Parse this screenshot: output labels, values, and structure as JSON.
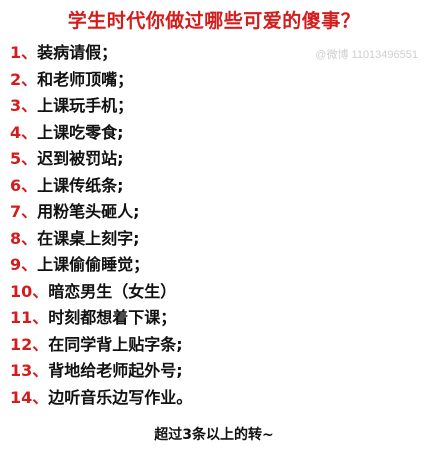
{
  "title": "学生时代你做过哪些可爱的傻事？",
  "watermark": "@微博 11013496551",
  "items": [
    {
      "num": "1、",
      "text": "装病请假；"
    },
    {
      "num": "2、",
      "text": "和老师顶嘴；"
    },
    {
      "num": "3、",
      "text": "上课玩手机；"
    },
    {
      "num": "4、",
      "text": "上课吃零食;"
    },
    {
      "num": "5、",
      "text": "迟到被罚站;"
    },
    {
      "num": "6、",
      "text": "上课传纸条;"
    },
    {
      "num": "7、",
      "text": "用粉笔头砸人;"
    },
    {
      "num": "8、",
      "text": "在课桌上刻字;"
    },
    {
      "num": "9、",
      "text": "上课偷偷睡觉；"
    },
    {
      "num": "10、",
      "text": "暗恋男生（女生）"
    },
    {
      "num": "11、",
      "text": "时刻都想着下课；"
    },
    {
      "num": "12、",
      "text": "在同学背上贴字条;"
    },
    {
      "num": "13、",
      "text": "背地给老师起外号;"
    },
    {
      "num": "14、",
      "text": "边听音乐边写作业。"
    }
  ],
  "footer": "超过3条以上的转~",
  "colors": {
    "number": "#d41c1c",
    "title": "#d41c1c",
    "text": "#111111"
  }
}
